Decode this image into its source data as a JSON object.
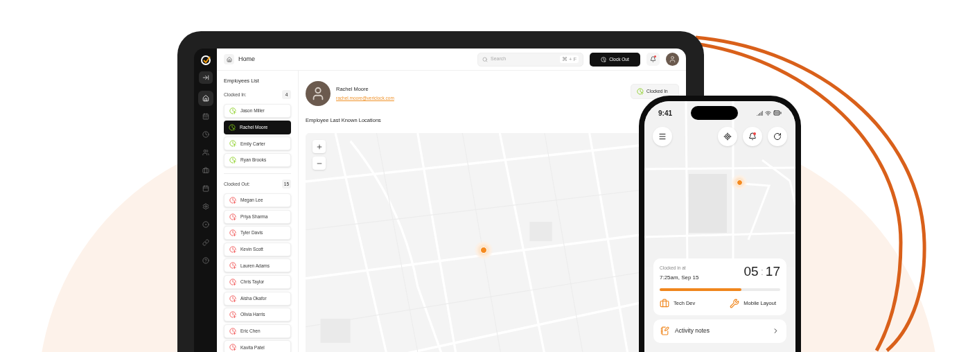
{
  "sidebar": {
    "items": [
      {
        "selected": true
      },
      {
        "selected": false
      },
      {
        "selected": false
      },
      {
        "selected": false
      },
      {
        "selected": false
      },
      {
        "selected": false
      },
      {
        "selected": false
      },
      {
        "selected": false
      },
      {
        "selected": false
      },
      {
        "selected": false
      }
    ]
  },
  "header": {
    "title": "Home",
    "search": {
      "placeholder": "Search",
      "shortcut": "⌘ + F"
    },
    "clock_out_button": "Clock Out",
    "notifications": {
      "unread": true
    }
  },
  "employees_list": {
    "title": "Employees List",
    "sections": [
      {
        "kind": "in",
        "label": "Clocked In:",
        "count": "4",
        "employees": [
          {
            "name": "Jason Miller",
            "selected": false
          },
          {
            "name": "Rachel Moore",
            "selected": true
          },
          {
            "name": "Emily Carter",
            "selected": false
          },
          {
            "name": "Ryan Brooks",
            "selected": false
          }
        ]
      },
      {
        "kind": "out",
        "label": "Clocked Out:",
        "count": "15",
        "employees": [
          {
            "name": "Megan Lee",
            "selected": false
          },
          {
            "name": "Priya Sharma",
            "selected": false
          },
          {
            "name": "Tyler Davis",
            "selected": false
          },
          {
            "name": "Kevin Scott",
            "selected": false
          },
          {
            "name": "Lauren Adams",
            "selected": false
          },
          {
            "name": "Chris Taylor",
            "selected": false
          },
          {
            "name": "Aisha Okafor",
            "selected": false
          },
          {
            "name": "Olivia Harris",
            "selected": false
          },
          {
            "name": "Eric Chen",
            "selected": false
          },
          {
            "name": "Kavita Patel",
            "selected": false
          }
        ]
      }
    ]
  },
  "employee": {
    "name": "Rachel Moore",
    "email": "rachel.moore@vericlock.com",
    "status_button": "Clocked In",
    "map_title": "Employee Last Known Locations"
  },
  "phone": {
    "time": "9:41",
    "notifications": {
      "unread": true
    },
    "shift": {
      "label": "Clocked in at",
      "start": "7:25am, Sep 15",
      "hours": "05",
      "separator": ":",
      "minutes": "17",
      "level": 0.68,
      "tags": [
        {
          "kind": "project",
          "label": "Tech Dev"
        },
        {
          "kind": "task",
          "label": "Mobile Layout"
        }
      ]
    },
    "notes_label": "Activity notes"
  }
}
